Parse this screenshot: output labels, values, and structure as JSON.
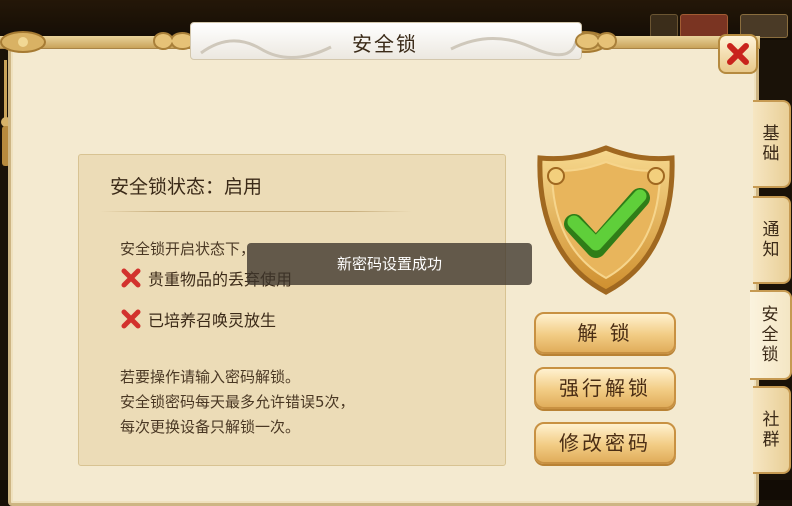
{
  "dialog": {
    "title": "安全锁",
    "close_icon": "close-x-icon"
  },
  "status": {
    "title": "安全锁状态：启用",
    "intro": "安全锁开启状态下，",
    "restrictions": [
      {
        "icon": "red-x-icon",
        "label": "贵重物品的丢弃使用"
      },
      {
        "icon": "red-x-icon",
        "label": "已培养召唤灵放生"
      }
    ],
    "notes": [
      "若要操作请输入密码解锁。",
      "安全锁密码每天最多允许错误5次，",
      "每次更换设备只解锁一次。"
    ]
  },
  "toast": {
    "message": "新密码设置成功"
  },
  "shield": {
    "icon": "shield-check-icon"
  },
  "actions": {
    "unlock": "解 锁",
    "force_unlock": "强行解锁",
    "change_password": "修改密码"
  },
  "tabs": [
    {
      "label": "基础",
      "active": false
    },
    {
      "label": "通知",
      "active": false
    },
    {
      "label": "安全锁",
      "active": true
    },
    {
      "label": "社群",
      "active": false
    }
  ],
  "colors": {
    "parchment": "#f4ead0",
    "content_box": "#ecdcb7",
    "button_gold": "#f2cc84",
    "check_green": "#46b52c",
    "cross_red": "#d2322d"
  }
}
